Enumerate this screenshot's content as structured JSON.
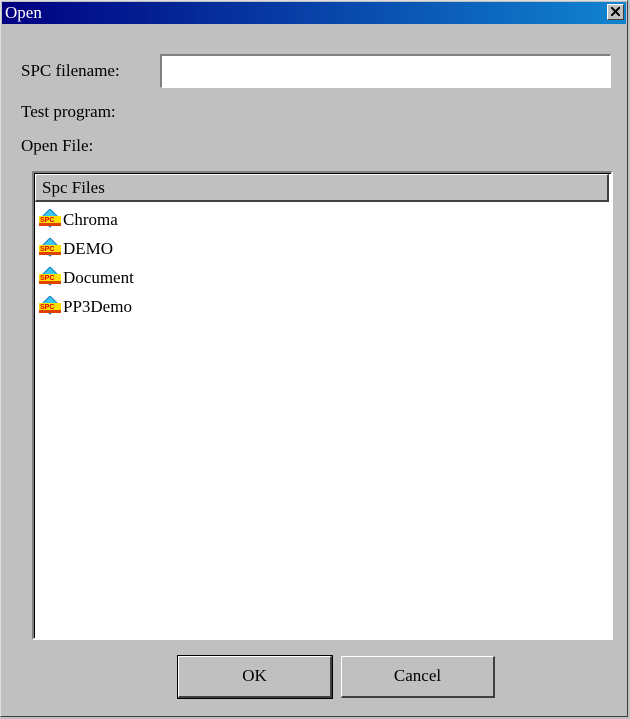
{
  "window": {
    "title": "Open"
  },
  "form": {
    "spc_filename_label": "SPC filename:",
    "spc_filename_value": "",
    "test_program_label": "Test program:",
    "open_file_label": "Open File:"
  },
  "list": {
    "header": "Spc Files",
    "items": [
      {
        "name": "Chroma",
        "icon": "spc-file-icon"
      },
      {
        "name": "DEMO",
        "icon": "spc-file-icon"
      },
      {
        "name": "Document",
        "icon": "spc-file-icon"
      },
      {
        "name": "PP3Demo",
        "icon": "spc-file-icon"
      }
    ]
  },
  "buttons": {
    "ok": "OK",
    "cancel": "Cancel"
  },
  "colors": {
    "title_start": "#000080",
    "title_end": "#1084d0",
    "face": "#c0c0c0"
  }
}
